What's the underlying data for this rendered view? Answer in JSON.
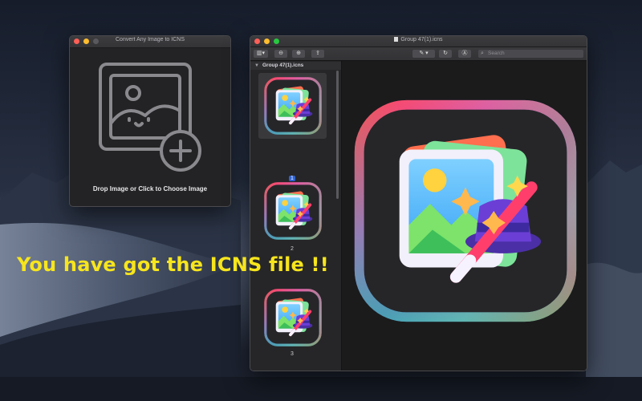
{
  "converter_window": {
    "title": "Convert Any Image to ICNS",
    "drop_label": "Drop Image or Click to Choose Image"
  },
  "preview_window": {
    "title": "Group 47(1).icns",
    "search_placeholder": "Search",
    "sidebar_header": "Group 47(1).icns",
    "pages": [
      "1",
      "2",
      "3"
    ]
  },
  "caption": "You have got the ICNS file !!",
  "colors": {
    "caption": "#f7e51d",
    "selection": "#2f62d1"
  },
  "icons": [
    "image-icon",
    "plus-circle-icon",
    "sidebar-toggle-icon",
    "zoom-out-icon",
    "zoom-in-icon",
    "share-icon",
    "pen-icon",
    "rotate-icon",
    "markup-icon",
    "search-icon",
    "app-icon"
  ]
}
